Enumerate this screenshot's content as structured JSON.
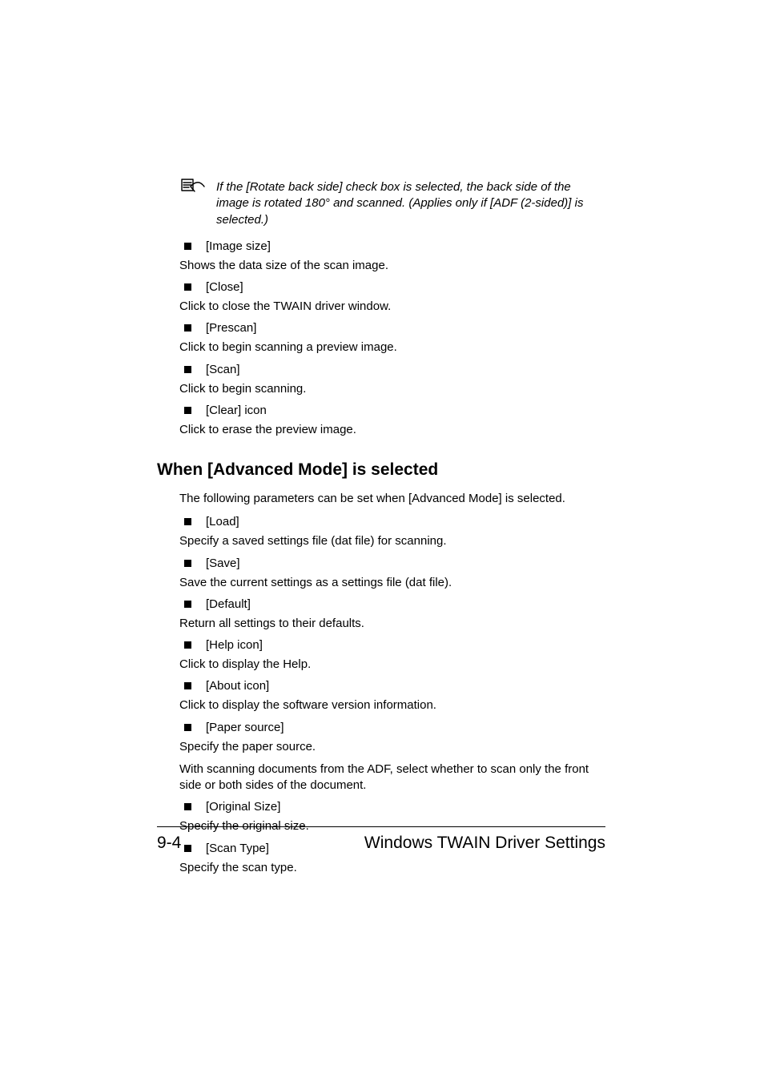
{
  "note": {
    "text": "If the [Rotate back side] check box is selected, the back side of the image is rotated 180° and scanned. (Applies only if [ADF (2-sided)] is selected.)"
  },
  "section1": {
    "items": [
      {
        "label": "[Image size]",
        "desc": "Shows the data size of the scan image."
      },
      {
        "label": "[Close]",
        "desc": "Click to close the TWAIN driver window."
      },
      {
        "label": "[Prescan]",
        "desc": "Click to begin scanning a preview image."
      },
      {
        "label": "[Scan]",
        "desc": "Click to begin scanning."
      },
      {
        "label": "[Clear] icon",
        "desc": "Click to erase the preview image."
      }
    ]
  },
  "heading": "When [Advanced Mode] is selected",
  "intro": "The following parameters can be set when [Advanced Mode] is selected.",
  "section2": {
    "items": [
      {
        "label": "[Load]",
        "desc": "Specify a saved settings file (dat file) for scanning."
      },
      {
        "label": "[Save]",
        "desc": "Save the current settings as a settings file (dat file)."
      },
      {
        "label": "[Default]",
        "desc": "Return all settings to their defaults."
      },
      {
        "label": "[Help icon]",
        "desc": "Click to display the Help."
      },
      {
        "label": "[About icon]",
        "desc": "Click to display the software version information."
      },
      {
        "label": "[Paper source]",
        "desc": "Specify the paper source.",
        "desc2": "With scanning documents from the ADF, select whether to scan only the front side or both sides of the document."
      },
      {
        "label": "[Original Size]",
        "desc": "Specify the original size."
      },
      {
        "label": "[Scan Type]",
        "desc": "Specify the scan type."
      }
    ]
  },
  "footer": {
    "page": "9-4",
    "title": "Windows TWAIN Driver Settings"
  }
}
